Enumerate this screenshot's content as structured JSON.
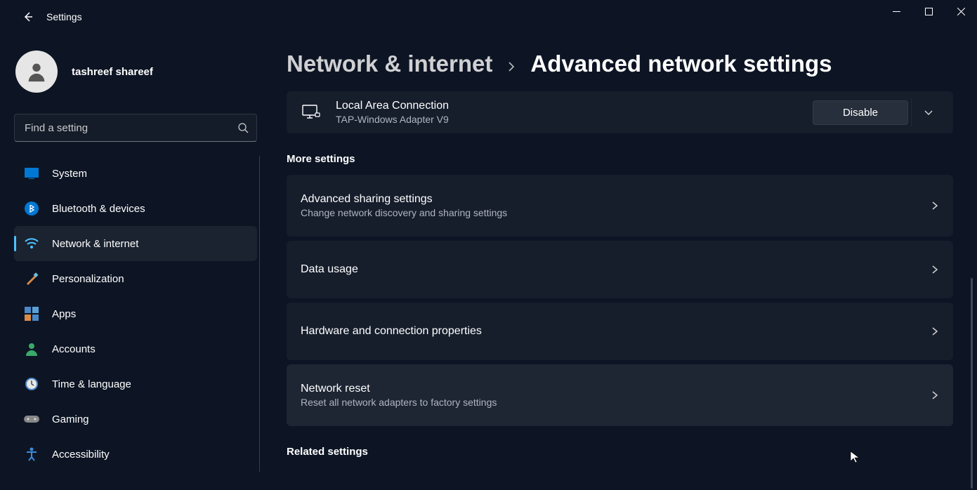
{
  "app": {
    "title": "Settings"
  },
  "profile": {
    "name": "tashreef shareef"
  },
  "search": {
    "placeholder": "Find a setting"
  },
  "sidebar": {
    "items": [
      {
        "label": "System"
      },
      {
        "label": "Bluetooth & devices"
      },
      {
        "label": "Network & internet"
      },
      {
        "label": "Personalization"
      },
      {
        "label": "Apps"
      },
      {
        "label": "Accounts"
      },
      {
        "label": "Time & language"
      },
      {
        "label": "Gaming"
      },
      {
        "label": "Accessibility"
      }
    ]
  },
  "breadcrumb": {
    "parent": "Network & internet",
    "current": "Advanced network settings"
  },
  "adapter": {
    "title": "Local Area Connection",
    "sub": "TAP-Windows Adapter V9",
    "button": "Disable"
  },
  "sections": {
    "more": "More settings",
    "related": "Related settings"
  },
  "more_items": [
    {
      "title": "Advanced sharing settings",
      "sub": "Change network discovery and sharing settings"
    },
    {
      "title": "Data usage",
      "sub": ""
    },
    {
      "title": "Hardware and connection properties",
      "sub": ""
    },
    {
      "title": "Network reset",
      "sub": "Reset all network adapters to factory settings"
    }
  ]
}
